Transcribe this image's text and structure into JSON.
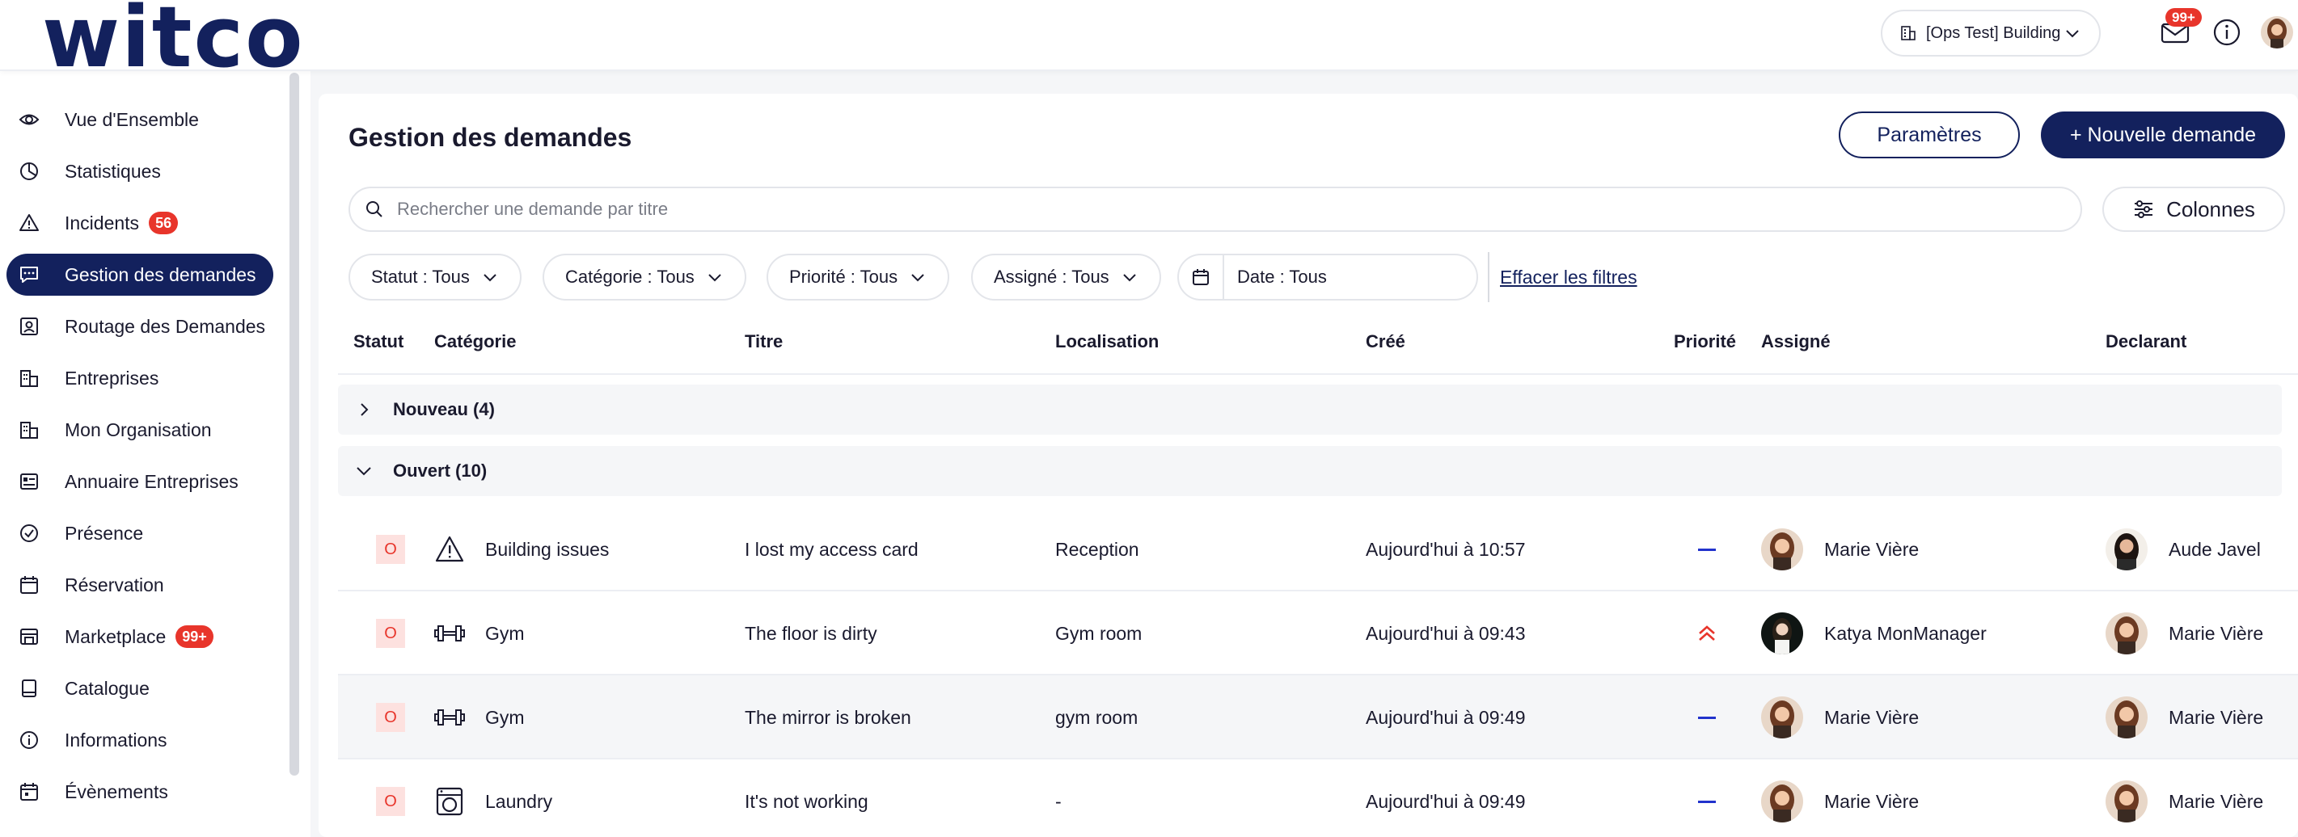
{
  "app": {
    "logo_text": "witco"
  },
  "topbar": {
    "building": "[Ops Test] Building",
    "mail_badge": "99+"
  },
  "sidebar": {
    "items": [
      {
        "label": "Vue d'Ensemble",
        "icon": "eye-icon"
      },
      {
        "label": "Statistiques",
        "icon": "pie-chart-icon"
      },
      {
        "label": "Incidents",
        "icon": "warning-icon",
        "badge": "56"
      },
      {
        "label": "Gestion des demandes",
        "icon": "chat-icon",
        "active": true
      },
      {
        "label": "Routage des Demandes",
        "icon": "contact-card-icon"
      },
      {
        "label": "Entreprises",
        "icon": "buildings-icon"
      },
      {
        "label": "Mon Organisation",
        "icon": "buildings-icon"
      },
      {
        "label": "Annuaire Entreprises",
        "icon": "directory-icon"
      },
      {
        "label": "Présence",
        "icon": "check-circle-icon"
      },
      {
        "label": "Réservation",
        "icon": "calendar-icon"
      },
      {
        "label": "Marketplace",
        "icon": "store-icon",
        "badge": "99+"
      },
      {
        "label": "Catalogue",
        "icon": "book-icon"
      },
      {
        "label": "Informations",
        "icon": "info-icon"
      },
      {
        "label": "Évènements",
        "icon": "calendar-event-icon"
      }
    ]
  },
  "main": {
    "title": "Gestion des demandes",
    "settings_label": "Paramètres",
    "new_label": "+ Nouvelle demande",
    "search_placeholder": "Rechercher une demande par titre",
    "columns_label": "Colonnes",
    "filters": {
      "status": "Statut : Tous",
      "category": "Catégorie : Tous",
      "priority": "Priorité : Tous",
      "assigned": "Assigné : Tous",
      "date": "Date : Tous",
      "clear": "Effacer les filtres"
    },
    "columns": [
      "Statut",
      "Catégorie",
      "Titre",
      "Localisation",
      "Créé",
      "Priorité",
      "Assigné",
      "Declarant"
    ],
    "groups": [
      {
        "label": "Nouveau (4)",
        "expanded": false
      },
      {
        "label": "Ouvert (10)",
        "expanded": true
      }
    ],
    "rows": [
      {
        "status": "O",
        "category": "Building issues",
        "category_icon": "warning-icon",
        "title": "I lost my access card",
        "location": "Reception",
        "created": "Aujourd'hui à 10:57",
        "priority": "normal",
        "assigned": "Marie Vière",
        "declarant": "Aude Javel"
      },
      {
        "status": "O",
        "category": "Gym",
        "category_icon": "dumbbell-icon",
        "title": "The floor is dirty",
        "location": "Gym room",
        "created": "Aujourd'hui à 09:43",
        "priority": "high",
        "assigned": "Katya MonManager",
        "declarant": "Marie Vière"
      },
      {
        "status": "O",
        "category": "Gym",
        "category_icon": "dumbbell-icon",
        "title": "The mirror is broken",
        "location": "gym room",
        "created": "Aujourd'hui à 09:49",
        "priority": "normal",
        "assigned": "Marie Vière",
        "declarant": "Marie Vière"
      },
      {
        "status": "O",
        "category": "Laundry",
        "category_icon": "washing-machine-icon",
        "title": "It's not working",
        "location": "-",
        "created": "Aujourd'hui à 09:49",
        "priority": "normal",
        "assigned": "Marie Vière",
        "declarant": "Marie Vière"
      }
    ]
  },
  "colors": {
    "brand": "#13215d",
    "badge": "#e8352b",
    "priority_normal": "#2233cc",
    "priority_high": "#e8352b",
    "status_bg": "#fde1df"
  }
}
